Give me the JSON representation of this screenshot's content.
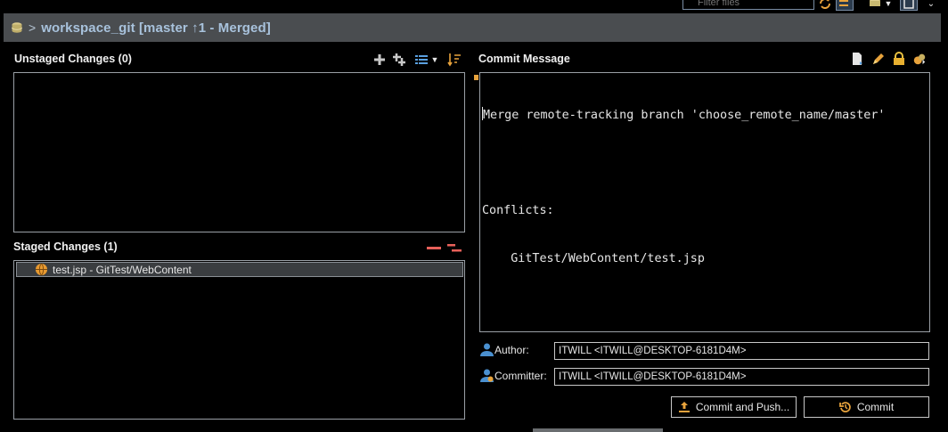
{
  "toolbar": {
    "filter_placeholder": "Filter files",
    "icons": [
      "refresh-icon",
      "pull-icon",
      "repository-icon",
      "dropdown-icon",
      "layout-icon",
      "view-menu-icon"
    ]
  },
  "header": {
    "arrow": ">",
    "title": "workspace_git [master ↑1 - Merged]"
  },
  "unstaged": {
    "title": "Unstaged Changes (0)",
    "items": []
  },
  "staged": {
    "title": "Staged Changes (1)",
    "items": [
      {
        "label": "test.jsp - GitTest/WebContent",
        "icon": "web-file-icon"
      }
    ]
  },
  "commit": {
    "title": "Commit Message",
    "message_lines": [
      "Merge remote-tracking branch 'choose_remote_name/master'",
      "",
      "Conflicts:",
      "    GitTest/WebContent/test.jsp"
    ],
    "author_label": "Author:",
    "author_value": "ITWILL <ITWILL@DESKTOP-6181D4M>",
    "committer_label": "Committer:",
    "committer_value": "ITWILL <ITWILL@DESKTOP-6181D4M>",
    "commit_and_push_label": "Commit and Push...",
    "commit_label": "Commit"
  },
  "colors": {
    "accent_orange": "#e8a33c",
    "title_blue": "#a8c2dc",
    "remove_red": "#e8605a",
    "list_blue": "#5aa0e0"
  }
}
